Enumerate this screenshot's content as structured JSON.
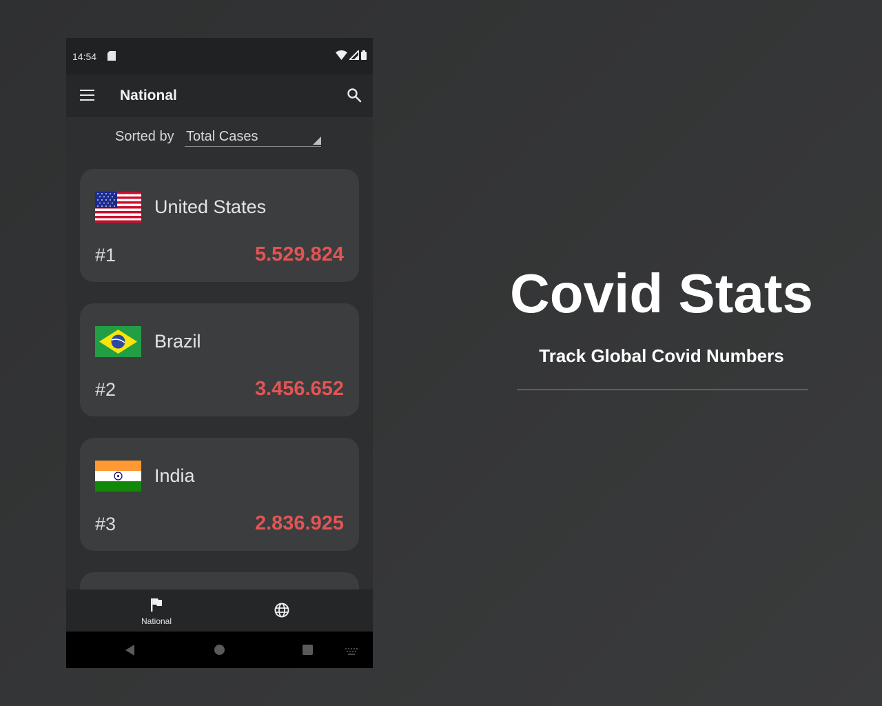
{
  "status_bar": {
    "time": "14:54"
  },
  "app_bar": {
    "title": "National"
  },
  "sort": {
    "label": "Sorted by",
    "value": "Total Cases"
  },
  "countries": [
    {
      "name": "United States",
      "rank": "#1",
      "cases": "5.529.824",
      "flag_icon": "us-flag-icon"
    },
    {
      "name": "Brazil",
      "rank": "#2",
      "cases": "3.456.652",
      "flag_icon": "brazil-flag-icon"
    },
    {
      "name": "India",
      "rank": "#3",
      "cases": "2.836.925",
      "flag_icon": "india-flag-icon"
    }
  ],
  "bottom_nav": {
    "items": [
      {
        "label": "National",
        "icon": "flag-icon",
        "selected": true
      },
      {
        "label": "",
        "icon": "globe-icon",
        "selected": false
      }
    ]
  },
  "hero": {
    "title": "Covid Stats",
    "subtitle": "Track Global Covid Numbers"
  },
  "colors": {
    "background": "#323334",
    "card": "#3c3d3e",
    "cases": "#e35454",
    "app_bar": "#262728"
  }
}
